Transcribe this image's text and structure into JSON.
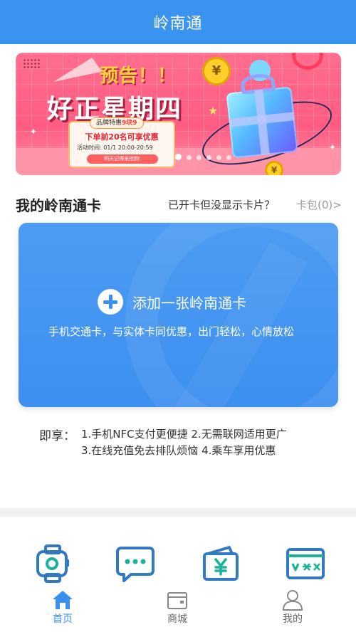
{
  "header": {
    "title": "岭南通"
  },
  "banner": {
    "preview_text": "预告！！",
    "headline": "好正星期四",
    "promo_tag_prefix": "品牌特惠",
    "promo_tag_price": "9块9",
    "promo_offer": "下单前20名可享优惠",
    "promo_time": "活动时间: 01/1 20:00-20:59",
    "promo_button": "明天记得来抢购!",
    "coin_symbol": "¥",
    "page_count": 6,
    "active_page": 1
  },
  "my_cards": {
    "title": "我的岭南通卡",
    "missing_card_link": "已开卡但没显示卡片？",
    "wallet_link": "卡包(0)>"
  },
  "add_card": {
    "label": "添加一张岭南通卡",
    "description": "手机交通卡，与实体卡同优惠，出门轻松，心情放松"
  },
  "benefits": {
    "label": "即享：",
    "line1": "1.手机NFC支付更便捷 2.无需联网适用更广",
    "line2": "3.在线充值免去排队烦恼 4.乘车享用优惠"
  },
  "shortcuts": [
    {
      "icon": "smartwatch-icon"
    },
    {
      "icon": "chat-message-icon"
    },
    {
      "icon": "yen-wallet-icon"
    },
    {
      "icon": "voucher-ticket-icon"
    }
  ],
  "tabbar": {
    "home": "首页",
    "mall": "商城",
    "me": "我的",
    "active": "home"
  },
  "colors": {
    "primary": "#3b93f0",
    "card_blue": "#4096f1",
    "icon_blue": "#3279c4",
    "icon_green": "#19b39a",
    "tab_inactive": "#666666",
    "tab_active": "#3b8ff0"
  }
}
